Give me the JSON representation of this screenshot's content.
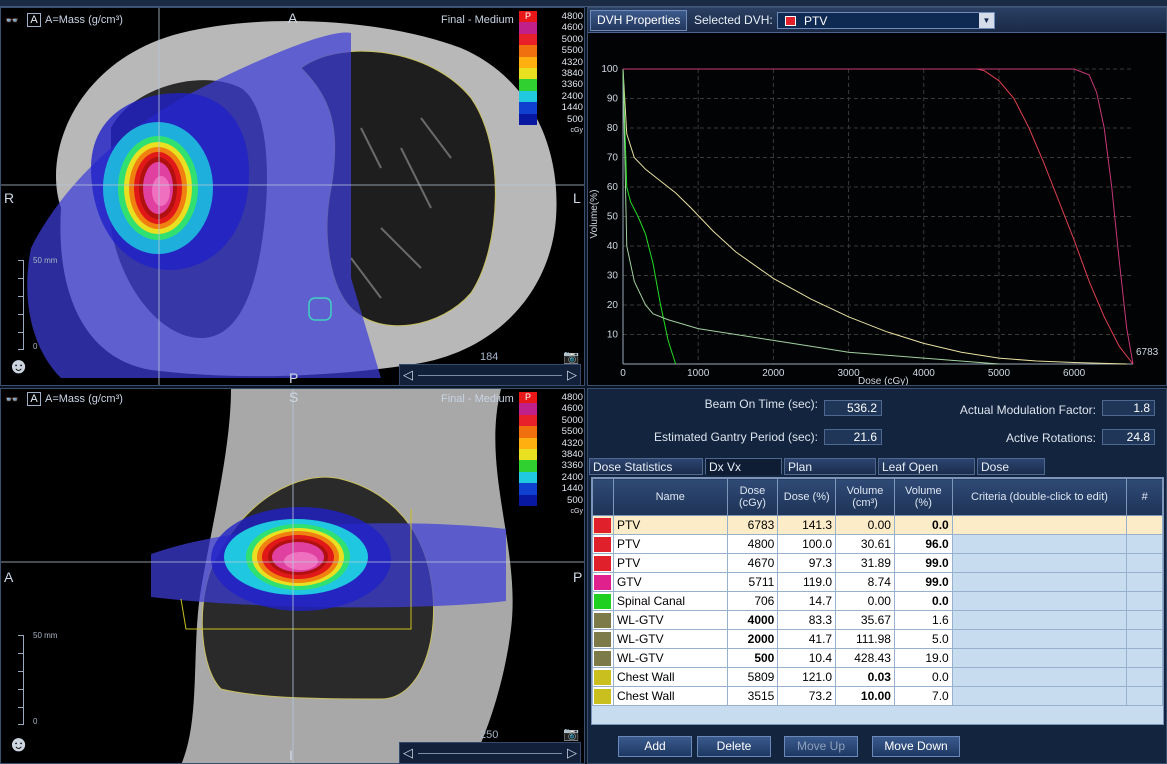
{
  "colors": {
    "accent": "#2a3f63",
    "ptv": "#e0202a",
    "gtv": "#e0208c",
    "spinal": "#20d020",
    "wlgtv": "#7c7a48",
    "chest": "#c9c020"
  },
  "axial": {
    "ct_label": "A",
    "density_label": "A=Mass (g/cm³)",
    "series_label": "Final - Medium",
    "legend_badge": "P",
    "legend_levels": [
      "4800",
      "4600",
      "5000",
      "5500",
      "4320",
      "3840",
      "3360",
      "2400",
      "1440",
      "500"
    ],
    "legend_unit": "cGy",
    "orient": {
      "top": "A",
      "bottom": "P",
      "left": "R",
      "right": "L"
    },
    "ruler_label": "50 mm",
    "ruler_zero": "0",
    "slice": "184"
  },
  "sagittal": {
    "ct_label": "A",
    "density_label": "A=Mass (g/cm³)",
    "series_label": "Final - Medium",
    "legend_badge": "P",
    "legend_levels": [
      "4800",
      "4600",
      "5000",
      "5500",
      "4320",
      "3840",
      "3360",
      "2400",
      "1440",
      "500"
    ],
    "legend_unit": "cGy",
    "orient": {
      "top": "S",
      "bottom": "I",
      "left": "A",
      "right": "P"
    },
    "ruler_label": "50 mm",
    "ruler_zero": "0",
    "slice": "250"
  },
  "dvh": {
    "tab_label": "DVH Properties",
    "selected_label": "Selected DVH:",
    "selected_value": "PTV",
    "ylabel": "Volume(%)",
    "xlabel": "Dose (cGy)",
    "max_label": "6783"
  },
  "chart_data": {
    "type": "line",
    "xlabel": "Dose (cGy)",
    "ylabel": "Volume(%)",
    "xlim": [
      0,
      6783
    ],
    "ylim": [
      0,
      100
    ],
    "xticks": [
      0,
      1000,
      2000,
      3000,
      4000,
      5000,
      6000
    ],
    "yticks": [
      10,
      20,
      30,
      40,
      50,
      60,
      70,
      80,
      90,
      100
    ],
    "grid": true,
    "series": [
      {
        "color": "#e8e0a0",
        "x": [
          0,
          50,
          150,
          300,
          500,
          700,
          900,
          1200,
          1500,
          2000,
          2500,
          3000,
          3500,
          4000,
          4500,
          5000,
          5500,
          6000,
          6700
        ],
        "y": [
          100,
          78,
          70,
          66,
          62,
          58,
          53,
          45,
          38,
          29,
          22,
          16,
          11,
          7,
          4,
          2,
          1,
          0.5,
          0
        ]
      },
      {
        "color": "#22dd22",
        "x": [
          0,
          50,
          100,
          200,
          300,
          400,
          500,
          600,
          700
        ],
        "y": [
          100,
          60,
          55,
          50,
          44,
          34,
          20,
          8,
          0
        ]
      },
      {
        "color": "#a0d0a0",
        "x": [
          0,
          50,
          150,
          300,
          400,
          600,
          1000,
          1500,
          2000,
          2500,
          3000,
          4000,
          5000
        ],
        "y": [
          100,
          40,
          28,
          20,
          17,
          15,
          12,
          10,
          8,
          6,
          4,
          2,
          0
        ]
      },
      {
        "color": "#e04050",
        "x": [
          0,
          4700,
          4800,
          5000,
          5200,
          5400,
          5600,
          5800,
          6000,
          6200,
          6400,
          6600,
          6783
        ],
        "y": [
          100,
          100,
          99.5,
          96,
          90,
          80,
          68,
          55,
          42,
          28,
          16,
          6,
          0
        ]
      },
      {
        "color": "#c83878",
        "x": [
          0,
          6000,
          6200,
          6300,
          6400,
          6500,
          6600,
          6700,
          6783
        ],
        "y": [
          100,
          100,
          98,
          92,
          80,
          60,
          35,
          12,
          0
        ]
      }
    ]
  },
  "plan": {
    "beam_on_label": "Beam On Time (sec):",
    "beam_on_value": "536.2",
    "gantry_label": "Estimated Gantry Period (sec):",
    "gantry_value": "21.6",
    "modulation_label": "Actual Modulation Factor:",
    "modulation_value": "1.8",
    "rotations_label": "Active Rotations:",
    "rotations_value": "24.8"
  },
  "tabs": [
    "Dose Statistics Table",
    "Dx Vx Values",
    "Plan Information",
    "Leaf Open Times",
    "Dose Points"
  ],
  "table": {
    "headers": {
      "name": "Name",
      "dose_cgy": "Dose (cGy)",
      "dose_pct": "Dose (%)",
      "vol_cm3": "Volume (cm³)",
      "vol_pct": "Volume (%)",
      "criteria": "Criteria (double-click to edit)",
      "hash": "#"
    },
    "rows": [
      {
        "name": "PTV",
        "dose": "6783",
        "dose_pct": "141.3",
        "vol": "0.00",
        "vol_pct": "0.0",
        "color": "#e0202a"
      },
      {
        "name": "PTV",
        "dose": "4800",
        "dose_pct": "100.0",
        "vol": "30.61",
        "vol_pct": "96.0",
        "color": "#e0202a"
      },
      {
        "name": "PTV",
        "dose": "4670",
        "dose_pct": "97.3",
        "vol": "31.89",
        "vol_pct": "99.0",
        "color": "#e0202a"
      },
      {
        "name": "GTV",
        "dose": "5711",
        "dose_pct": "119.0",
        "vol": "8.74",
        "vol_pct": "99.0",
        "color": "#e0208c"
      },
      {
        "name": "Spinal Canal",
        "dose": "706",
        "dose_pct": "14.7",
        "vol": "0.00",
        "vol_pct": "0.0",
        "color": "#20d020"
      },
      {
        "name": "WL-GTV",
        "dose": "4000",
        "dose_pct": "83.3",
        "vol": "35.67",
        "vol_pct": "1.6",
        "color": "#7c7a48"
      },
      {
        "name": "WL-GTV",
        "dose": "2000",
        "dose_pct": "41.7",
        "vol": "111.98",
        "vol_pct": "5.0",
        "color": "#7c7a48"
      },
      {
        "name": "WL-GTV",
        "dose": "500",
        "dose_pct": "10.4",
        "vol": "428.43",
        "vol_pct": "19.0",
        "color": "#7c7a48"
      },
      {
        "name": "Chest Wall",
        "dose": "5809",
        "dose_pct": "121.0",
        "vol": "0.03",
        "vol_pct": "0.0",
        "color": "#c9c020"
      },
      {
        "name": "Chest Wall",
        "dose": "3515",
        "dose_pct": "73.2",
        "vol": "10.00",
        "vol_pct": "7.0",
        "color": "#c9c020"
      }
    ]
  },
  "buttons": {
    "add": "Add",
    "delete": "Delete",
    "move_up": "Move Up",
    "move_down": "Move Down"
  }
}
